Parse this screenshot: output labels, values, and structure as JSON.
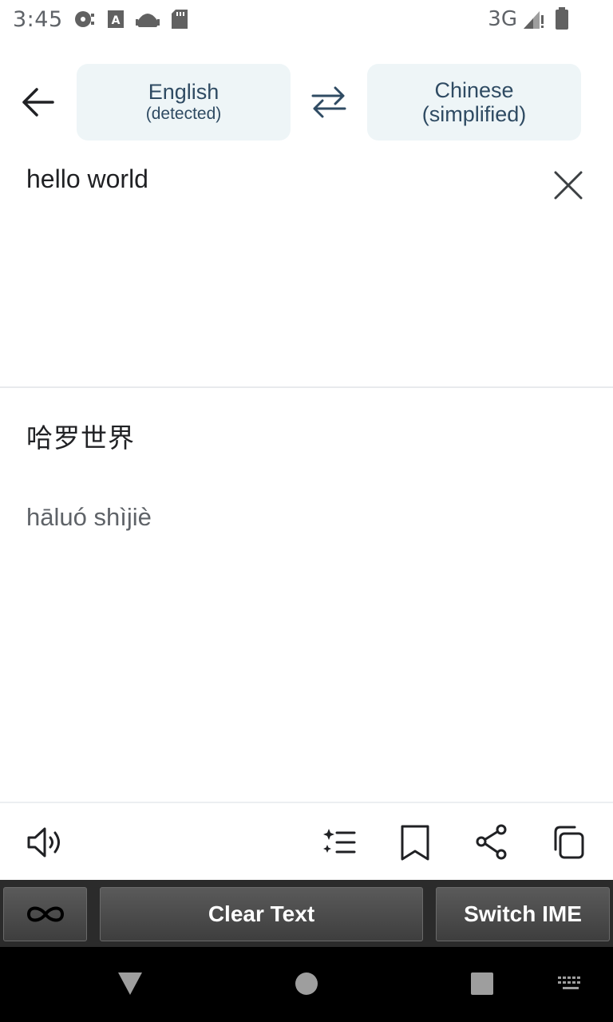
{
  "status_bar": {
    "time": "3:45",
    "network": "3G",
    "icons": [
      "media-icon",
      "font-app-icon",
      "android-icon",
      "sd-card-icon",
      "signal-icon",
      "battery-icon"
    ]
  },
  "top_bar": {
    "source_language": "English",
    "source_detail": "(detected)",
    "target_language": "Chinese",
    "target_detail": "(simplified)"
  },
  "input": {
    "text": "hello world"
  },
  "output": {
    "translation": "哈罗世界",
    "romanization": "hāluó shìjiè"
  },
  "actions": [
    "speaker-icon",
    "alternatives-icon",
    "bookmark-icon",
    "share-icon",
    "copy-icon"
  ],
  "ime_bar": {
    "clear_label": "Clear Text",
    "switch_label": "Switch IME"
  },
  "colors": {
    "chip_bg": "#eef5f7",
    "chip_text": "#2f4b63",
    "ime_bar_bg": "#2b2b2b"
  }
}
